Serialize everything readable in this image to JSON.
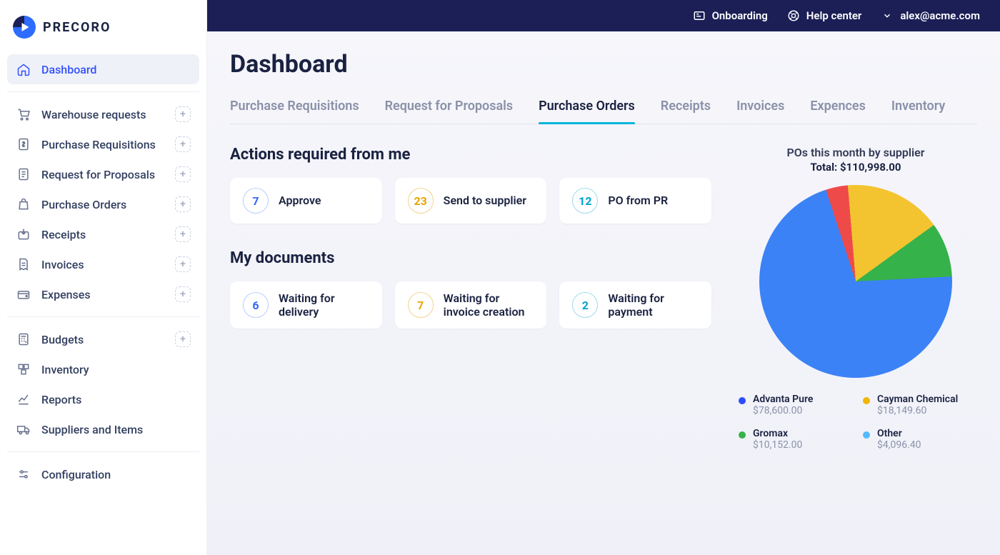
{
  "brand": "PRECORO",
  "topbar": {
    "onboarding": "Onboarding",
    "help": "Help center",
    "user_email": "alex@acme.com"
  },
  "sidebar": [
    {
      "id": "dashboard",
      "label": "Dashboard",
      "icon": "home",
      "plus": false,
      "active": true
    },
    null,
    {
      "id": "wh-req",
      "label": "Warehouse requests",
      "icon": "cart",
      "plus": true
    },
    {
      "id": "pr",
      "label": "Purchase Requisitions",
      "icon": "doc-money",
      "plus": true
    },
    {
      "id": "rfp",
      "label": "Request for Proposals",
      "icon": "doc-list",
      "plus": true
    },
    {
      "id": "po",
      "label": "Purchase Orders",
      "icon": "bag",
      "plus": true
    },
    {
      "id": "receipts",
      "label": "Receipts",
      "icon": "box-in",
      "plus": true
    },
    {
      "id": "invoices",
      "label": "Invoices",
      "icon": "invoice",
      "plus": true
    },
    {
      "id": "expenses",
      "label": "Expenses",
      "icon": "wallet",
      "plus": true
    },
    null,
    {
      "id": "budgets",
      "label": "Budgets",
      "icon": "calc",
      "plus": true
    },
    {
      "id": "inventory",
      "label": "Inventory",
      "icon": "boxes",
      "plus": false
    },
    {
      "id": "reports",
      "label": "Reports",
      "icon": "chart",
      "plus": false
    },
    {
      "id": "suppliers",
      "label": "Suppliers and Items",
      "icon": "truck",
      "plus": false
    },
    null,
    {
      "id": "config",
      "label": "Configuration",
      "icon": "sliders",
      "plus": false
    }
  ],
  "page_title": "Dashboard",
  "tabs": [
    {
      "id": "pr-tab",
      "label": "Purchase Requisitions",
      "active": false
    },
    {
      "id": "rfp-tab",
      "label": "Request for Proposals",
      "active": false
    },
    {
      "id": "po-tab",
      "label": "Purchase Orders",
      "active": true
    },
    {
      "id": "receipts-tab",
      "label": "Receipts",
      "active": false
    },
    {
      "id": "invoices-tab",
      "label": "Invoices",
      "active": false
    },
    {
      "id": "expenses-tab",
      "label": "Expences",
      "active": false
    },
    {
      "id": "inventory-tab",
      "label": "Inventory",
      "active": false
    }
  ],
  "sections": {
    "actions_title": "Actions required from me",
    "documents_title": "My documents"
  },
  "actions_cards": [
    {
      "count": "7",
      "label": "Approve",
      "color": "blue"
    },
    {
      "count": "23",
      "label": "Send to supplier",
      "color": "amber"
    },
    {
      "count": "12",
      "label": "PO from PR",
      "color": "cyan"
    }
  ],
  "doc_cards": [
    {
      "count": "6",
      "label": "Waiting for delivery",
      "color": "blue"
    },
    {
      "count": "7",
      "label": "Waiting for invoice creation",
      "color": "amber"
    },
    {
      "count": "2",
      "label": "Waiting for payment",
      "color": "cyan"
    }
  ],
  "chart_data": {
    "type": "pie",
    "title": "POs this month by supplier",
    "total_label": "Total: $110,998.00",
    "series": [
      {
        "name": "Advanta Pure",
        "value": 78600.0,
        "value_label": "$78,600.00",
        "color": "#2f7df6"
      },
      {
        "name": "Cayman Chemical",
        "value": 18149.6,
        "value_label": "$18,149.60",
        "color": "#f1b600"
      },
      {
        "name": "Gromax",
        "value": 10152.0,
        "value_label": "$10,152.00",
        "color": "#36b24a"
      },
      {
        "name": "Other",
        "value": 4096.4,
        "value_label": "$4,096.40",
        "color": "#54b9ff"
      }
    ]
  },
  "colors": {
    "accent": "#3450ff",
    "tab_active": "#00b4dd"
  }
}
